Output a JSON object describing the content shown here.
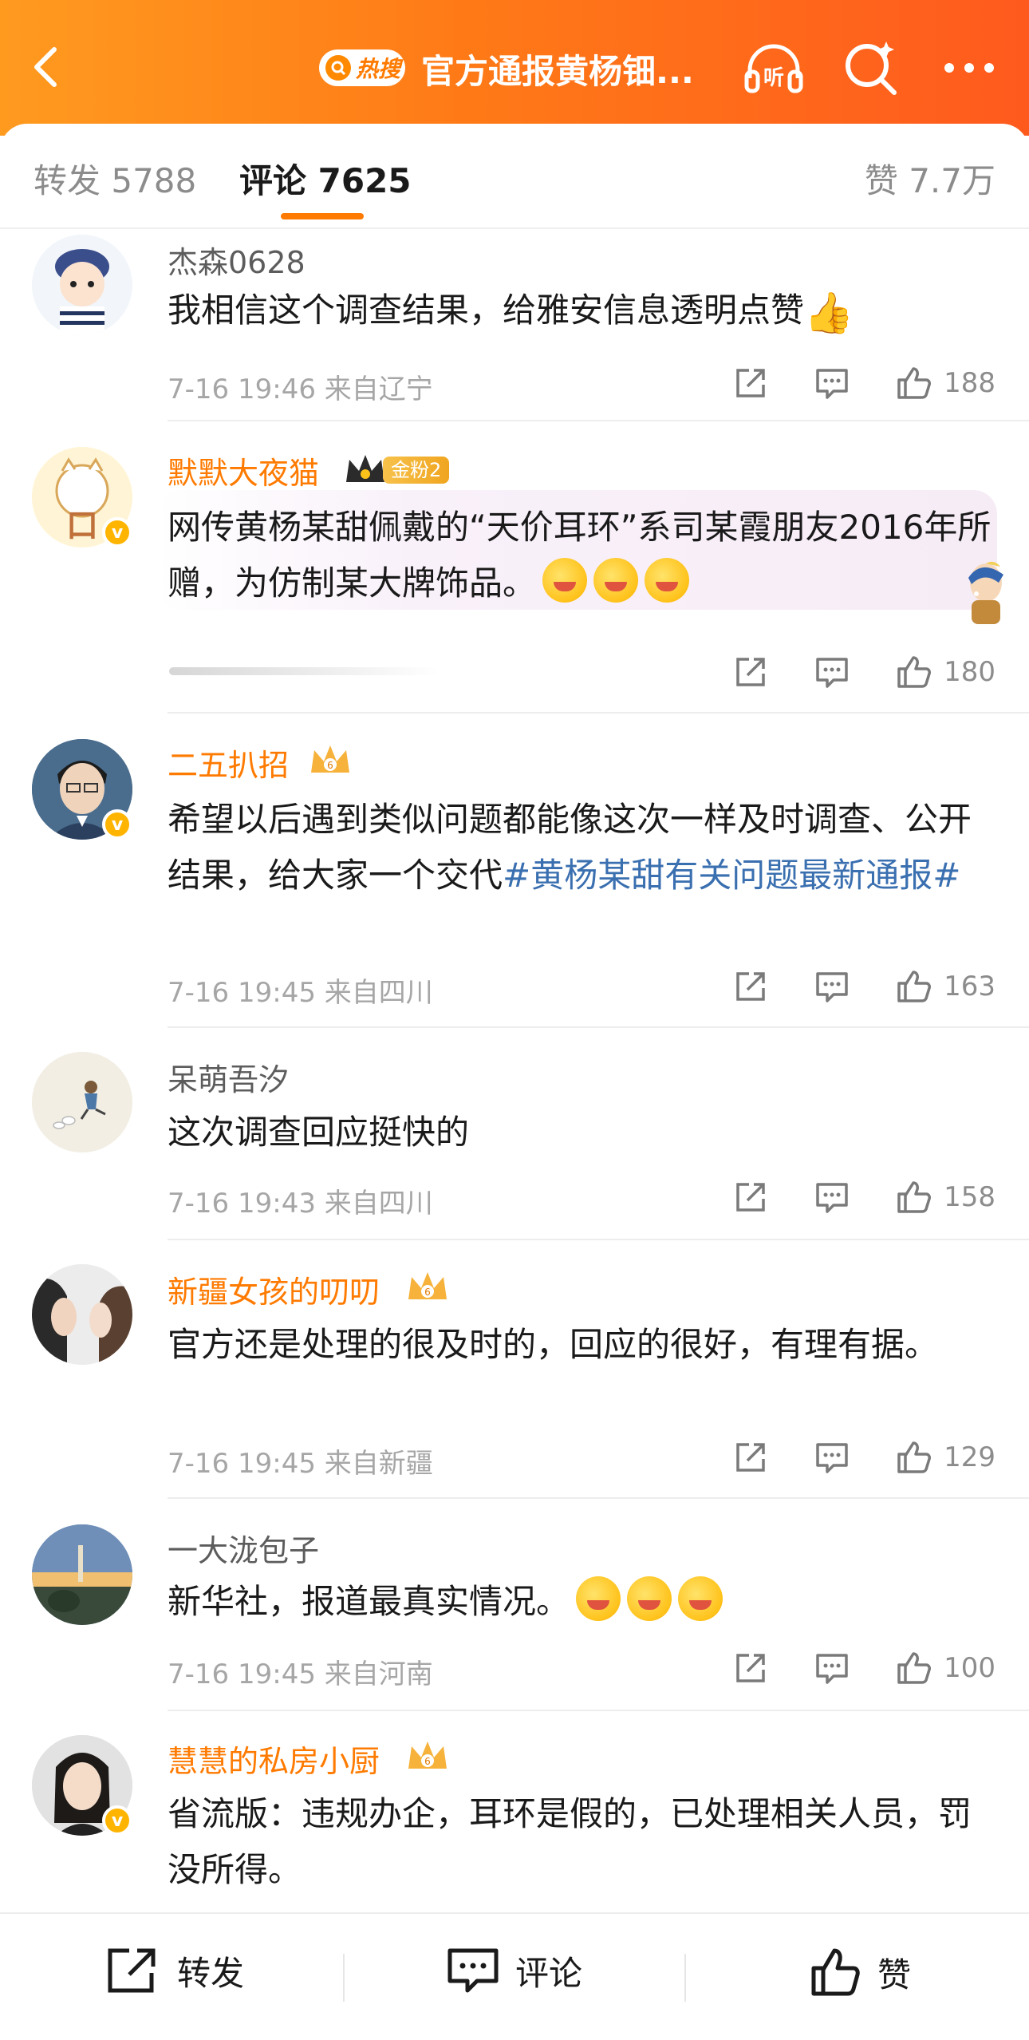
{
  "header": {
    "hot_label": "热搜",
    "title": "官方通报黄杨钿...",
    "gradient": [
      "#ff9a1f",
      "#ff5a1e"
    ]
  },
  "tabs": {
    "repost": "转发 5788",
    "comment": "评论 7625",
    "like": "赞 7.7万",
    "accent": "#ff7a00"
  },
  "comments": [
    {
      "name": "杰森0628",
      "text": "我相信这个调查结果，给雅安信息透明点赞",
      "time": "7-16 19:46",
      "location": "来自辽宁",
      "likes": "188"
    },
    {
      "name": "默默大夜猫",
      "fan_badge": "金粉2",
      "text": "网传黄杨某甜佩戴的“天价耳环”系司某霞朋友2016年所赠，为仿制某大牌饰品。",
      "likes": "180"
    },
    {
      "name": "二五扒招",
      "text": "希望以后遇到类似问题都能像这次一样及时调查、公开结果，给大家一个交代",
      "tag": "#黄杨某甜有关问题最新通报#",
      "time": "7-16 19:45",
      "location": "来自四川",
      "likes": "163"
    },
    {
      "name": "呆萌吾汐",
      "text": "这次调查回应挺快的",
      "time": "7-16 19:43",
      "location": "来自四川",
      "likes": "158"
    },
    {
      "name": "新疆女孩的叨叨",
      "text": "官方还是处理的很及时的，回应的很好，有理有据。",
      "time": "7-16 19:45",
      "location": "来自新疆",
      "likes": "129"
    },
    {
      "name": "一大泷包子",
      "text": "新华社，报道最真实情况。",
      "time": "7-16 19:45",
      "location": "来自河南",
      "likes": "100"
    },
    {
      "name": "慧慧的私房小厨",
      "text": "省流版：违规办企，耳环是假的，已处理相关人员，罚没所得。"
    }
  ],
  "bottom": {
    "repost": "转发",
    "comment": "评论",
    "like": "赞"
  }
}
